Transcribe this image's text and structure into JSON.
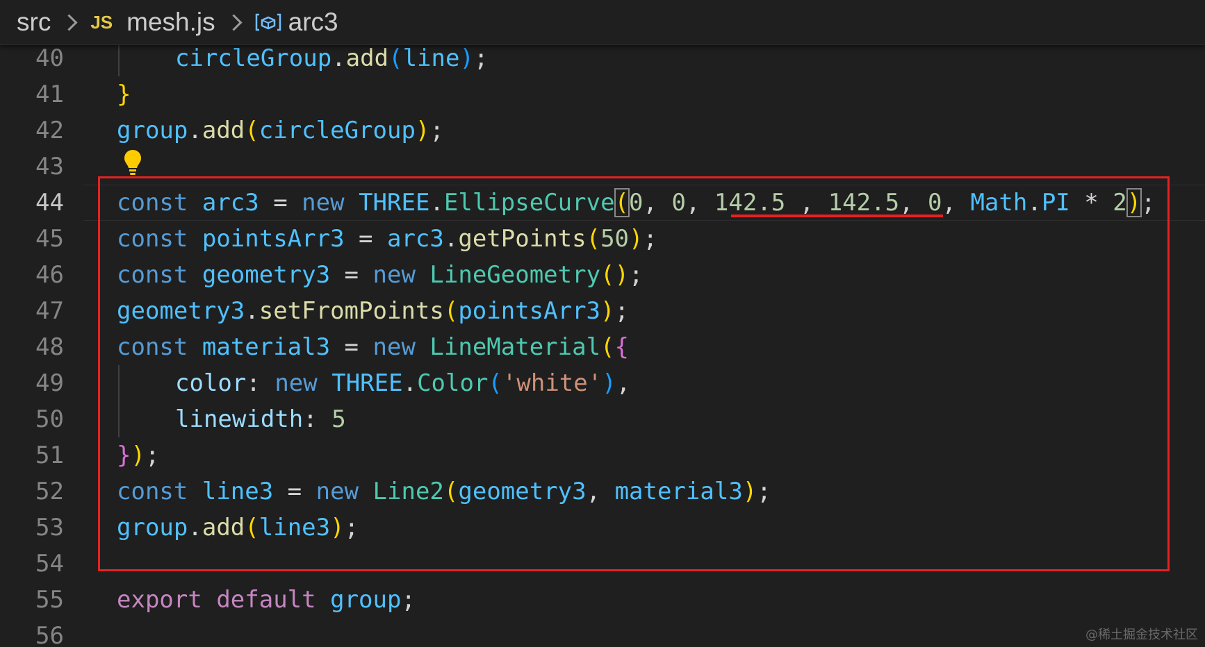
{
  "breadcrumb": {
    "folder": "src",
    "file_icon": "JS",
    "file": "mesh.js",
    "symbol_icon": "variable-icon",
    "symbol": "arc3"
  },
  "editor": {
    "active_line": 44,
    "lines": [
      {
        "n": "40",
        "tokens": [
          [
            "circleGroup",
            "var"
          ],
          [
            ".",
            "pn"
          ],
          [
            "add",
            "fn"
          ],
          [
            "(",
            "b3"
          ],
          [
            "line",
            "var"
          ],
          [
            ")",
            "b3"
          ],
          [
            ";",
            "pn"
          ]
        ],
        "indent": 1
      },
      {
        "n": "41",
        "tokens": [
          [
            "}",
            "b1"
          ]
        ],
        "indent": 0
      },
      {
        "n": "42",
        "tokens": [
          [
            "group",
            "var"
          ],
          [
            ".",
            "pn"
          ],
          [
            "add",
            "fn"
          ],
          [
            "(",
            "b1"
          ],
          [
            "circleGroup",
            "var"
          ],
          [
            ")",
            "b1"
          ],
          [
            ";",
            "pn"
          ]
        ],
        "indent": 0
      },
      {
        "n": "43",
        "tokens": [],
        "indent": 0
      },
      {
        "n": "44",
        "tokens": [
          [
            "const",
            "kw"
          ],
          [
            " ",
            "pn"
          ],
          [
            "arc3",
            "var"
          ],
          [
            " = ",
            "pn"
          ],
          [
            "new",
            "kw"
          ],
          [
            " ",
            "pn"
          ],
          [
            "THREE",
            "var"
          ],
          [
            ".",
            "pn"
          ],
          [
            "EllipseCurve",
            "cls"
          ],
          [
            "(",
            "b1 bmatch"
          ],
          [
            "0",
            "num"
          ],
          [
            ", ",
            "pn"
          ],
          [
            "0",
            "num"
          ],
          [
            ", ",
            "pn"
          ],
          [
            "142.5",
            "num"
          ],
          [
            " , ",
            "pn"
          ],
          [
            "142.5",
            "num"
          ],
          [
            ", ",
            "pn"
          ],
          [
            "0",
            "num"
          ],
          [
            ", ",
            "pn"
          ],
          [
            "Math",
            "var"
          ],
          [
            ".",
            "pn"
          ],
          [
            "PI",
            "var"
          ],
          [
            " * ",
            "pn"
          ],
          [
            "2",
            "num"
          ],
          [
            ")",
            "b1 bmatch"
          ],
          [
            ";",
            "pn"
          ]
        ],
        "indent": 0
      },
      {
        "n": "45",
        "tokens": [
          [
            "const",
            "kw"
          ],
          [
            " ",
            "pn"
          ],
          [
            "pointsArr3",
            "var"
          ],
          [
            " = ",
            "pn"
          ],
          [
            "arc3",
            "var"
          ],
          [
            ".",
            "pn"
          ],
          [
            "getPoints",
            "fn"
          ],
          [
            "(",
            "b1"
          ],
          [
            "50",
            "num"
          ],
          [
            ")",
            "b1"
          ],
          [
            ";",
            "pn"
          ]
        ],
        "indent": 0
      },
      {
        "n": "46",
        "tokens": [
          [
            "const",
            "kw"
          ],
          [
            " ",
            "pn"
          ],
          [
            "geometry3",
            "var"
          ],
          [
            " = ",
            "pn"
          ],
          [
            "new",
            "kw"
          ],
          [
            " ",
            "pn"
          ],
          [
            "LineGeometry",
            "cls"
          ],
          [
            "()",
            "b1"
          ],
          [
            ";",
            "pn"
          ]
        ],
        "indent": 0
      },
      {
        "n": "47",
        "tokens": [
          [
            "geometry3",
            "var"
          ],
          [
            ".",
            "pn"
          ],
          [
            "setFromPoints",
            "fn"
          ],
          [
            "(",
            "b1"
          ],
          [
            "pointsArr3",
            "var"
          ],
          [
            ")",
            "b1"
          ],
          [
            ";",
            "pn"
          ]
        ],
        "indent": 0
      },
      {
        "n": "48",
        "tokens": [
          [
            "const",
            "kw"
          ],
          [
            " ",
            "pn"
          ],
          [
            "material3",
            "var"
          ],
          [
            " = ",
            "pn"
          ],
          [
            "new",
            "kw"
          ],
          [
            " ",
            "pn"
          ],
          [
            "LineMaterial",
            "cls"
          ],
          [
            "(",
            "b1"
          ],
          [
            "{",
            "b2"
          ]
        ],
        "indent": 0
      },
      {
        "n": "49",
        "tokens": [
          [
            "color",
            "prop"
          ],
          [
            ": ",
            "pn"
          ],
          [
            "new",
            "kw"
          ],
          [
            " ",
            "pn"
          ],
          [
            "THREE",
            "var"
          ],
          [
            ".",
            "pn"
          ],
          [
            "Color",
            "cls"
          ],
          [
            "(",
            "b3"
          ],
          [
            "'white'",
            "str"
          ],
          [
            ")",
            "b3"
          ],
          [
            ",",
            "pn"
          ]
        ],
        "indent": 1
      },
      {
        "n": "50",
        "tokens": [
          [
            "linewidth",
            "prop"
          ],
          [
            ": ",
            "pn"
          ],
          [
            "5",
            "num"
          ]
        ],
        "indent": 1
      },
      {
        "n": "51",
        "tokens": [
          [
            "}",
            "b2"
          ],
          [
            ")",
            "b1"
          ],
          [
            ";",
            "pn"
          ]
        ],
        "indent": 0
      },
      {
        "n": "52",
        "tokens": [
          [
            "const",
            "kw"
          ],
          [
            " ",
            "pn"
          ],
          [
            "line3",
            "var"
          ],
          [
            " = ",
            "pn"
          ],
          [
            "new",
            "kw"
          ],
          [
            " ",
            "pn"
          ],
          [
            "Line2",
            "cls"
          ],
          [
            "(",
            "b1"
          ],
          [
            "geometry3",
            "var"
          ],
          [
            ", ",
            "pn"
          ],
          [
            "material3",
            "var"
          ],
          [
            ")",
            "b1"
          ],
          [
            ";",
            "pn"
          ]
        ],
        "indent": 0
      },
      {
        "n": "53",
        "tokens": [
          [
            "group",
            "var"
          ],
          [
            ".",
            "pn"
          ],
          [
            "add",
            "fn"
          ],
          [
            "(",
            "b1"
          ],
          [
            "line3",
            "var"
          ],
          [
            ")",
            "b1"
          ],
          [
            ";",
            "pn"
          ]
        ],
        "indent": 0
      },
      {
        "n": "54",
        "tokens": [],
        "indent": 0
      },
      {
        "n": "55",
        "tokens": [
          [
            "export",
            "kw2"
          ],
          [
            " ",
            "pn"
          ],
          [
            "default",
            "kw2"
          ],
          [
            " ",
            "pn"
          ],
          [
            "group",
            "var"
          ],
          [
            ";",
            "pn"
          ]
        ],
        "indent": 0
      },
      {
        "n": "56",
        "tokens": [],
        "indent": 0
      }
    ]
  },
  "annotation": {
    "box_color": "#e52222"
  },
  "watermark": "@稀土掘金技术社区",
  "colors": {
    "background": "#1f1f1f",
    "keyword": "#569cd6",
    "variable": "#4fc1ff",
    "function": "#dcdcaa",
    "class": "#4ec9b0",
    "number": "#b5cea8",
    "string": "#ce9178"
  }
}
